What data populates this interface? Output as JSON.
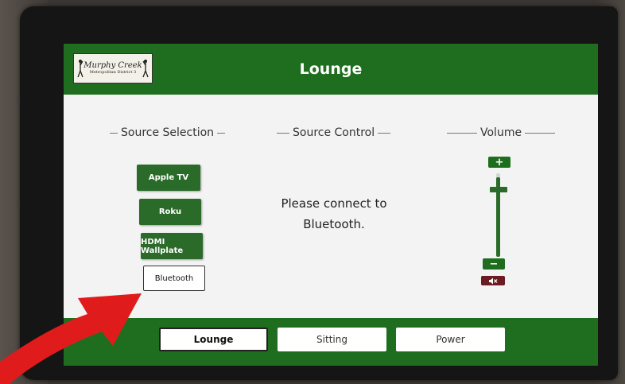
{
  "header": {
    "title": "Lounge",
    "logo": {
      "name": "Murphy Creek",
      "subtitle": "Metropolitan District 3"
    }
  },
  "sections": {
    "source_selection": "Source Selection",
    "source_control": "Source Control",
    "volume": "Volume"
  },
  "sources": [
    {
      "label": "Apple TV",
      "selected": false
    },
    {
      "label": "Roku",
      "selected": false
    },
    {
      "label": "HDMI Wallplate",
      "selected": false
    },
    {
      "label": "Bluetooth",
      "selected": true
    }
  ],
  "source_message": {
    "line1": "Please connect to",
    "line2": "Bluetooth."
  },
  "volume": {
    "plus": "+",
    "minus": "−",
    "level": 0.85,
    "mute_icon": "speaker-mute-icon"
  },
  "rooms": [
    {
      "label": "Lounge",
      "selected": true
    },
    {
      "label": "Sitting",
      "selected": false
    },
    {
      "label": "Power",
      "selected": false
    }
  ],
  "colors": {
    "brand_green": "#1f6e1f",
    "button_green": "#2a6b2a",
    "mute_red": "#6b1c22",
    "arrow_red": "#e01b1b"
  }
}
